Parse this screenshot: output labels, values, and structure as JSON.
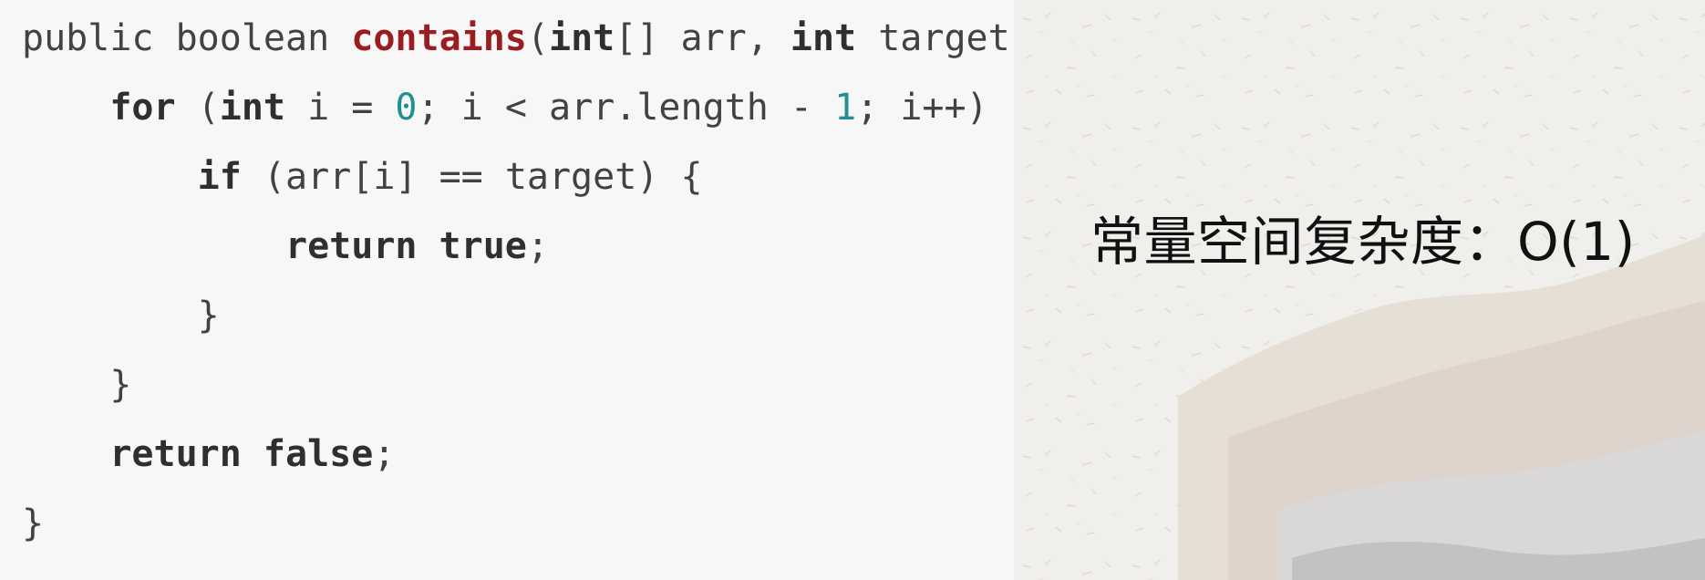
{
  "code_panel": {
    "lines": [
      {
        "indent": "",
        "tokens": [
          {
            "text": "public boolean ",
            "kind": "plain"
          },
          {
            "text": "contains",
            "kind": "fn"
          },
          {
            "text": "(",
            "kind": "plain"
          },
          {
            "text": "int",
            "kind": "kw"
          },
          {
            "text": "[] arr, ",
            "kind": "plain"
          },
          {
            "text": "int",
            "kind": "kw"
          },
          {
            "text": " target) {",
            "kind": "plain"
          }
        ]
      },
      {
        "indent": "    ",
        "tokens": [
          {
            "text": "for",
            "kind": "kw"
          },
          {
            "text": " (",
            "kind": "plain"
          },
          {
            "text": "int",
            "kind": "kw"
          },
          {
            "text": " i = ",
            "kind": "plain"
          },
          {
            "text": "0",
            "kind": "num"
          },
          {
            "text": "; i < arr.length - ",
            "kind": "plain"
          },
          {
            "text": "1",
            "kind": "num"
          },
          {
            "text": "; i++) {",
            "kind": "plain"
          }
        ]
      },
      {
        "indent": "        ",
        "tokens": [
          {
            "text": "if",
            "kind": "kw"
          },
          {
            "text": " (arr[i] == target) {",
            "kind": "plain"
          }
        ]
      },
      {
        "indent": "            ",
        "tokens": [
          {
            "text": "return true",
            "kind": "kw"
          },
          {
            "text": ";",
            "kind": "plain"
          }
        ]
      },
      {
        "indent": "        ",
        "tokens": [
          {
            "text": "}",
            "kind": "plain"
          }
        ]
      },
      {
        "indent": "    ",
        "tokens": [
          {
            "text": "}",
            "kind": "plain"
          }
        ]
      },
      {
        "indent": "    ",
        "tokens": [
          {
            "text": "return false",
            "kind": "kw"
          },
          {
            "text": ";",
            "kind": "plain"
          }
        ]
      },
      {
        "indent": "",
        "tokens": [
          {
            "text": "}",
            "kind": "plain"
          }
        ]
      }
    ],
    "colors": {
      "keyword": "#2f2f2f",
      "function": "#9b1d22",
      "number": "#1f8f8f",
      "plain": "#424242",
      "background": "#f7f7f8"
    }
  },
  "slide": {
    "caption": "常量空间复杂度：O(1)",
    "background_color": "#f1efec"
  }
}
